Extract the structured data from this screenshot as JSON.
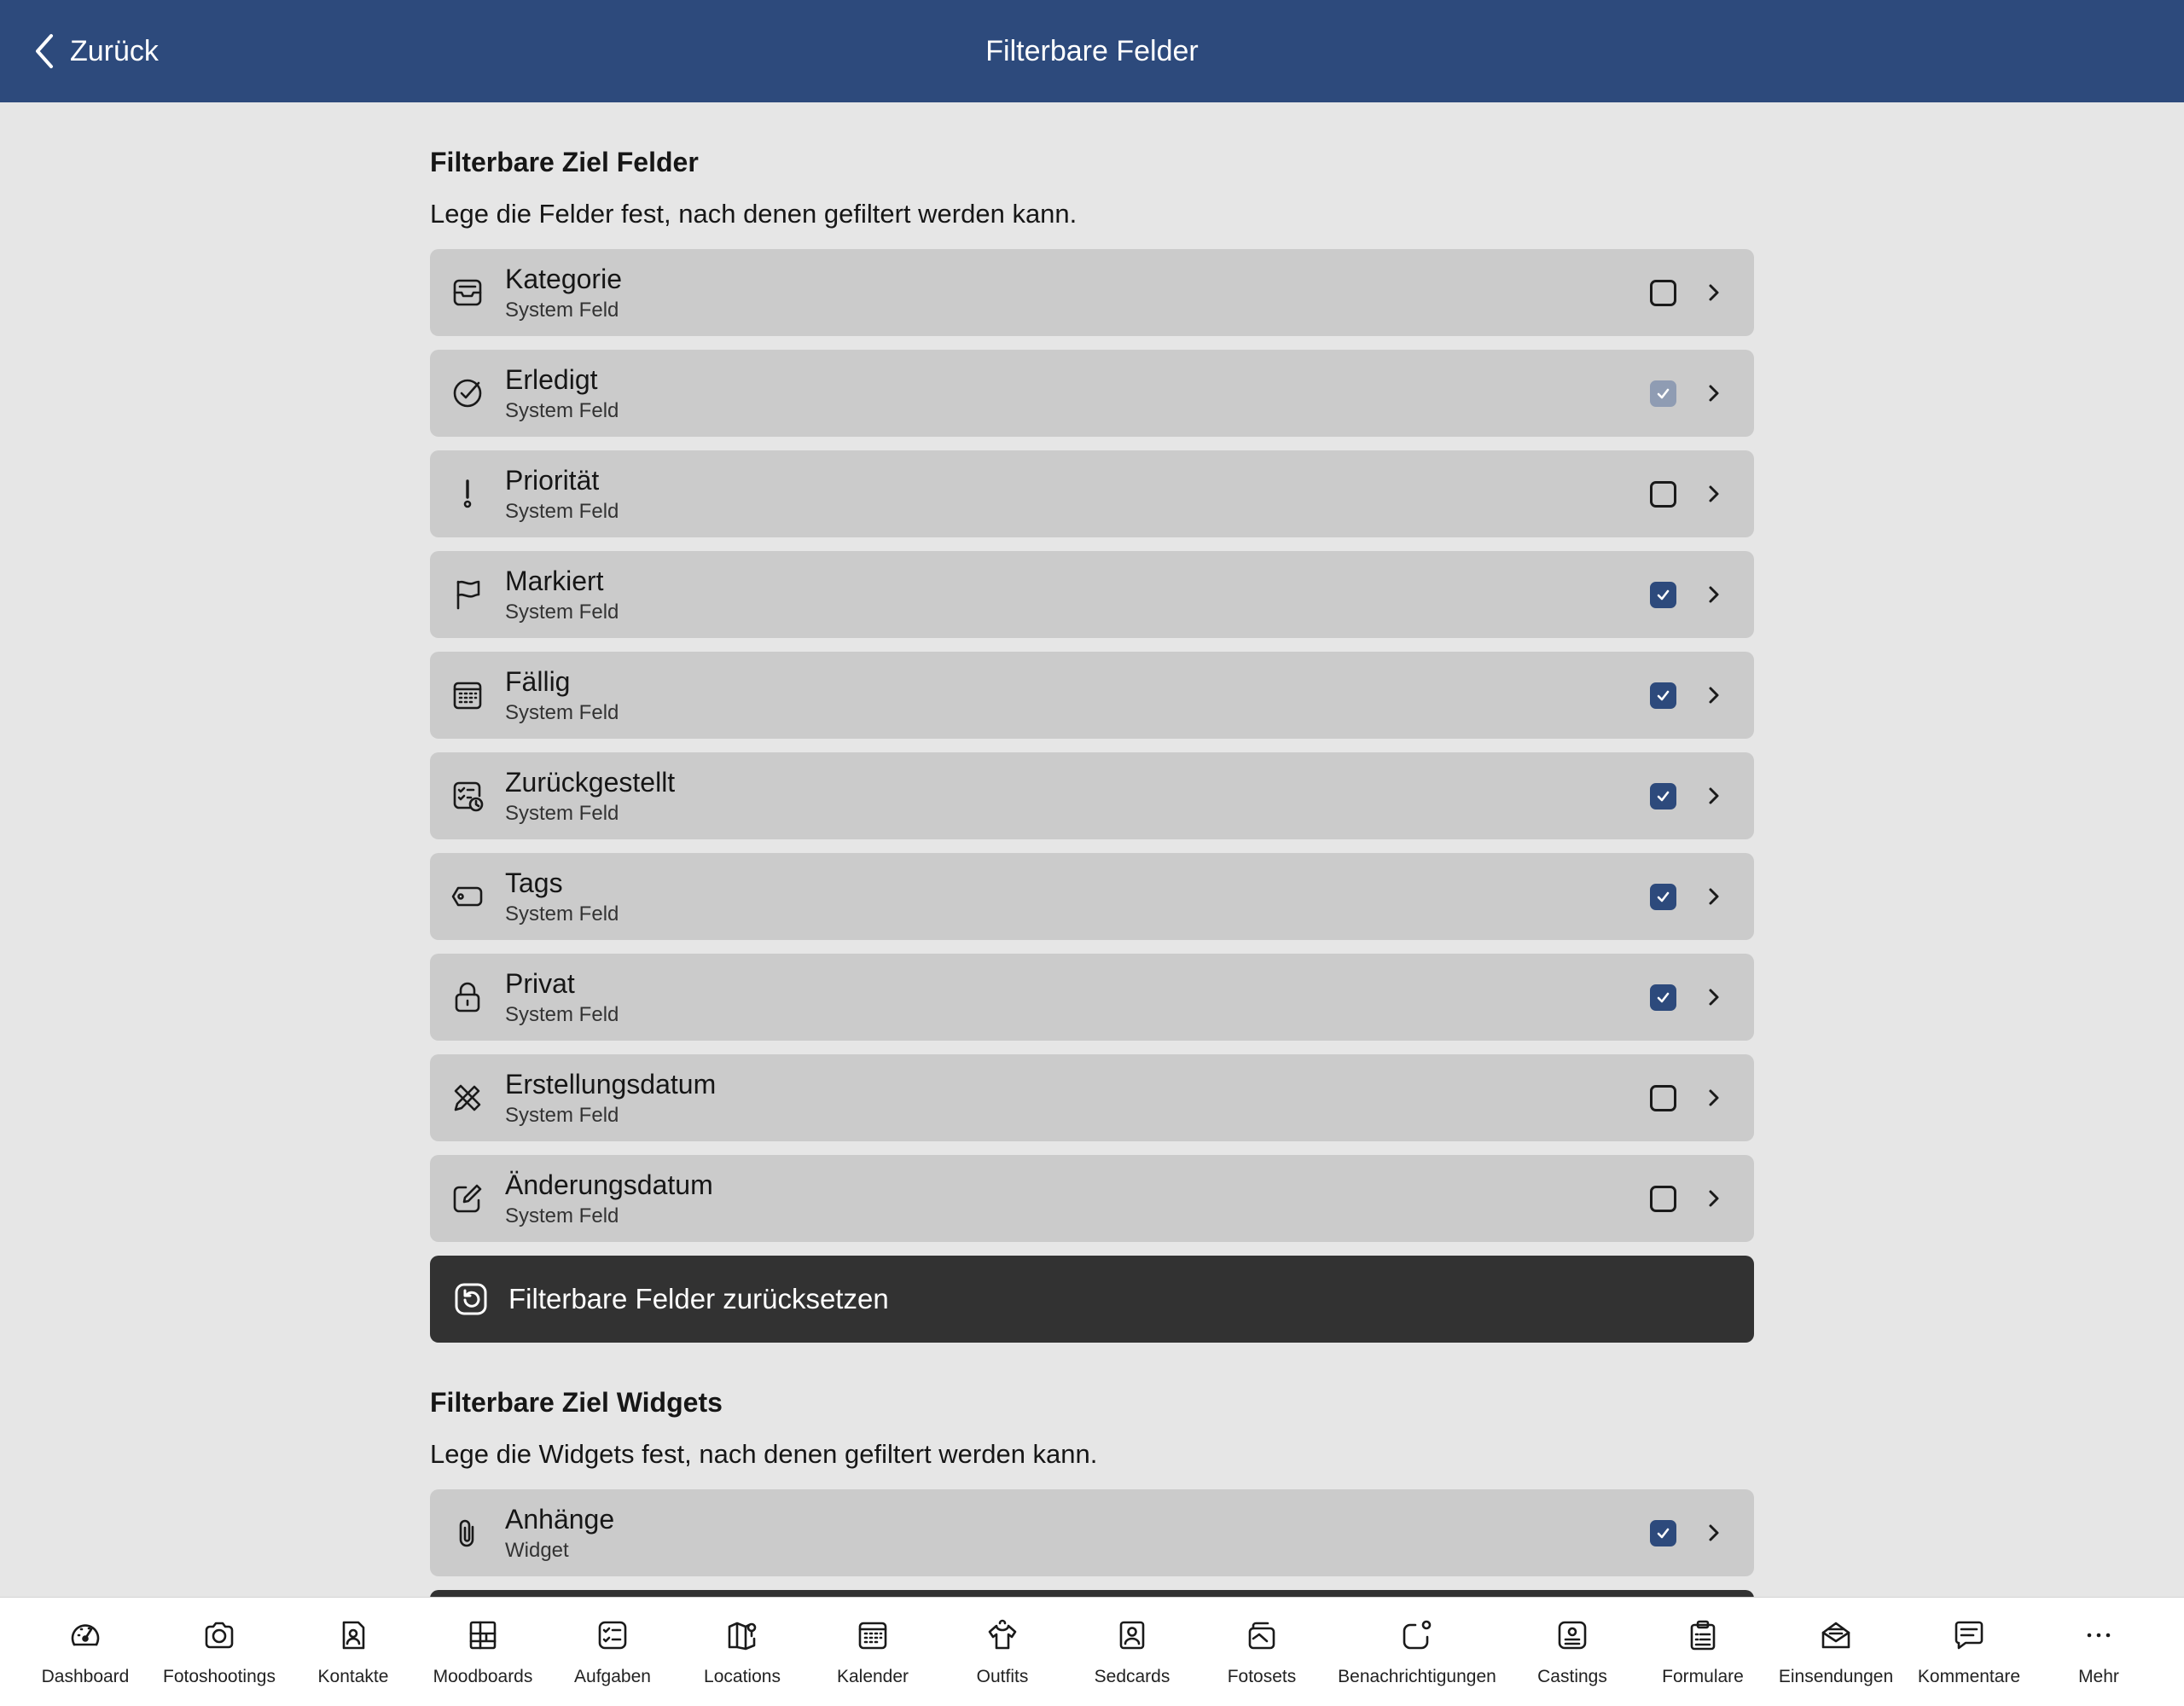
{
  "header": {
    "back_label": "Zurück",
    "title": "Filterbare Felder"
  },
  "fields_section": {
    "title": "Filterbare Ziel Felder",
    "description": "Lege die Felder fest, nach denen gefiltert werden kann.",
    "items": [
      {
        "label": "Kategorie",
        "subtitle": "System Feld",
        "icon": "tray-icon",
        "checked": false,
        "disabled": false
      },
      {
        "label": "Erledigt",
        "subtitle": "System Feld",
        "icon": "check-circle-icon",
        "checked": true,
        "disabled": true
      },
      {
        "label": "Priorität",
        "subtitle": "System Feld",
        "icon": "exclamation-icon",
        "checked": false,
        "disabled": false
      },
      {
        "label": "Markiert",
        "subtitle": "System Feld",
        "icon": "flag-icon",
        "checked": true,
        "disabled": false
      },
      {
        "label": "Fällig",
        "subtitle": "System Feld",
        "icon": "calendar-icon",
        "checked": true,
        "disabled": false
      },
      {
        "label": "Zurückgestellt",
        "subtitle": "System Feld",
        "icon": "checklist-clock-icon",
        "checked": true,
        "disabled": false
      },
      {
        "label": "Tags",
        "subtitle": "System Feld",
        "icon": "tag-icon",
        "checked": true,
        "disabled": false
      },
      {
        "label": "Privat",
        "subtitle": "System Feld",
        "icon": "lock-icon",
        "checked": true,
        "disabled": false
      },
      {
        "label": "Erstellungsdatum",
        "subtitle": "System Feld",
        "icon": "pencil-ruler-icon",
        "checked": false,
        "disabled": false
      },
      {
        "label": "Änderungsdatum",
        "subtitle": "System Feld",
        "icon": "edit-icon",
        "checked": false,
        "disabled": false
      }
    ],
    "reset_label": "Filterbare Felder zurücksetzen"
  },
  "widgets_section": {
    "title": "Filterbare Ziel Widgets",
    "description": "Lege die Widgets fest, nach denen gefiltert werden kann.",
    "items": [
      {
        "label": "Anhänge",
        "subtitle": "Widget",
        "icon": "paperclip-icon",
        "checked": true,
        "disabled": false
      }
    ]
  },
  "tabbar": [
    {
      "label": "Dashboard",
      "icon": "gauge-icon"
    },
    {
      "label": "Fotoshootings",
      "icon": "camera-icon"
    },
    {
      "label": "Kontakte",
      "icon": "contact-icon"
    },
    {
      "label": "Moodboards",
      "icon": "moodboard-icon"
    },
    {
      "label": "Aufgaben",
      "icon": "tasks-icon"
    },
    {
      "label": "Locations",
      "icon": "map-icon"
    },
    {
      "label": "Kalender",
      "icon": "calendar-icon"
    },
    {
      "label": "Outfits",
      "icon": "shirt-icon"
    },
    {
      "label": "Sedcards",
      "icon": "sedcard-icon"
    },
    {
      "label": "Fotosets",
      "icon": "photosets-icon"
    },
    {
      "label": "Benachrichtigungen",
      "icon": "notification-icon"
    },
    {
      "label": "Castings",
      "icon": "casting-icon"
    },
    {
      "label": "Formulare",
      "icon": "clipboard-icon"
    },
    {
      "label": "Einsendungen",
      "icon": "mail-open-icon"
    },
    {
      "label": "Kommentare",
      "icon": "comment-icon"
    },
    {
      "label": "Mehr",
      "icon": "more-icon"
    }
  ],
  "colors": {
    "accent": "#2d4a7c",
    "background": "#e6e6e6",
    "row": "#cbcbcb",
    "reset_button": "#323232",
    "checkbox_disabled": "#8f9cb3"
  }
}
